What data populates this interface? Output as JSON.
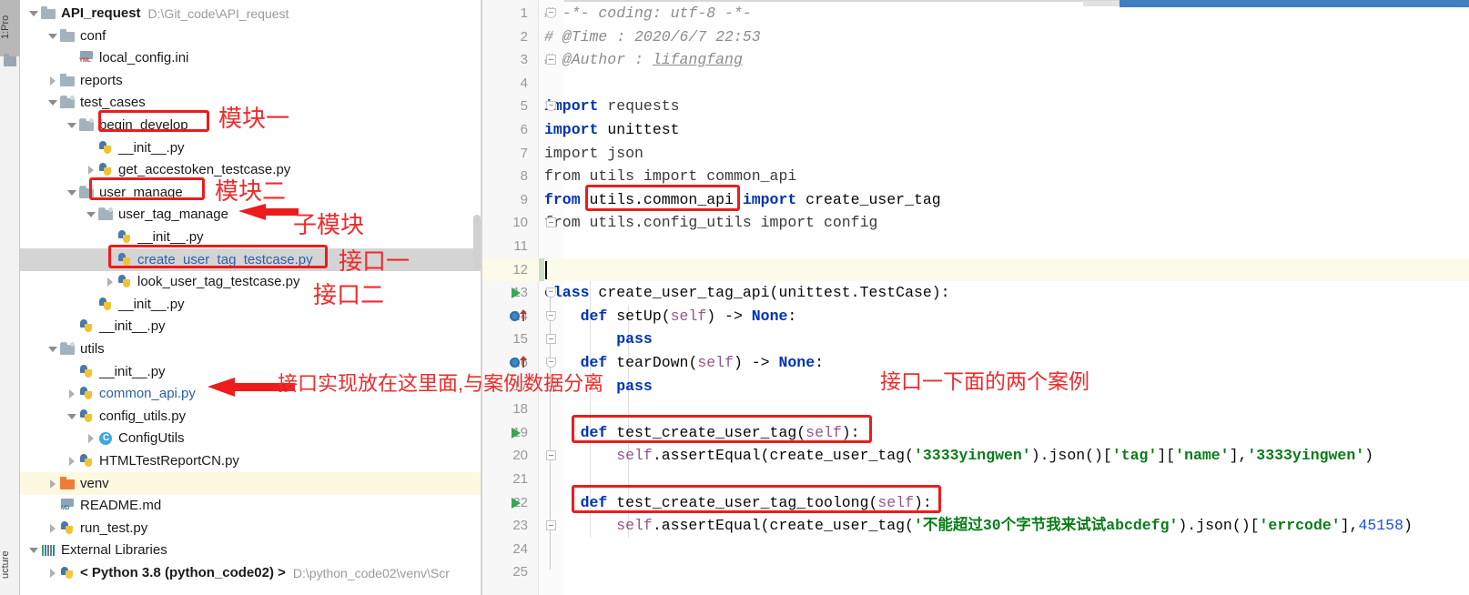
{
  "toolwindows": {
    "project_tab": "1:Pro",
    "structure_tab": "ucture",
    "folder_icon": "folder-icon"
  },
  "project_tree": {
    "root": {
      "label": "API_request",
      "path": "D:\\Git_code\\API_request"
    },
    "items": [
      {
        "label": "API_request",
        "path": "D:\\Git_code\\API_request",
        "icon": "folder-icon",
        "arrow": "down",
        "indent": 0,
        "bold": true,
        "blue": false,
        "state": "normal"
      },
      {
        "label": "conf",
        "path": "",
        "icon": "folder-icon",
        "arrow": "down",
        "indent": 1,
        "bold": false,
        "blue": false,
        "state": "normal"
      },
      {
        "label": "local_config.ini",
        "path": "",
        "icon": "ini-file-icon",
        "arrow": "none",
        "indent": 2,
        "bold": false,
        "blue": false,
        "state": "normal"
      },
      {
        "label": "reports",
        "path": "",
        "icon": "folder-icon",
        "arrow": "right",
        "indent": 1,
        "bold": false,
        "blue": false,
        "state": "normal"
      },
      {
        "label": "test_cases",
        "path": "",
        "icon": "source-folder-icon",
        "arrow": "down",
        "indent": 1,
        "bold": false,
        "blue": false,
        "state": "normal"
      },
      {
        "label": "begin_develop",
        "path": "",
        "icon": "source-folder-icon",
        "arrow": "down",
        "indent": 2,
        "bold": false,
        "blue": false,
        "state": "normal"
      },
      {
        "label": "__init__.py",
        "path": "",
        "icon": "python-file-icon",
        "arrow": "none",
        "indent": 3,
        "bold": false,
        "blue": false,
        "state": "normal"
      },
      {
        "label": "get_accestoken_testcase.py",
        "path": "",
        "icon": "python-file-icon",
        "arrow": "right",
        "indent": 3,
        "bold": false,
        "blue": false,
        "state": "normal"
      },
      {
        "label": "user_manage",
        "path": "",
        "icon": "source-folder-icon",
        "arrow": "down",
        "indent": 2,
        "bold": false,
        "blue": false,
        "state": "normal"
      },
      {
        "label": "user_tag_manage",
        "path": "",
        "icon": "source-folder-icon",
        "arrow": "down",
        "indent": 3,
        "bold": false,
        "blue": false,
        "state": "normal"
      },
      {
        "label": "__init__.py",
        "path": "",
        "icon": "python-file-icon",
        "arrow": "none",
        "indent": 4,
        "bold": false,
        "blue": false,
        "state": "normal"
      },
      {
        "label": "create_user_tag_testcase.py",
        "path": "",
        "icon": "python-file-icon",
        "arrow": "none",
        "indent": 4,
        "bold": false,
        "blue": true,
        "state": "selected"
      },
      {
        "label": "look_user_tag_testcase.py",
        "path": "",
        "icon": "python-file-icon",
        "arrow": "right",
        "indent": 4,
        "bold": false,
        "blue": false,
        "state": "normal"
      },
      {
        "label": "__init__.py",
        "path": "",
        "icon": "python-file-icon",
        "arrow": "none",
        "indent": 3,
        "bold": false,
        "blue": false,
        "state": "normal"
      },
      {
        "label": "__init__.py",
        "path": "",
        "icon": "python-file-icon",
        "arrow": "none",
        "indent": 2,
        "bold": false,
        "blue": false,
        "state": "normal"
      },
      {
        "label": "utils",
        "path": "",
        "icon": "source-folder-icon",
        "arrow": "down",
        "indent": 1,
        "bold": false,
        "blue": false,
        "state": "normal"
      },
      {
        "label": "__init__.py",
        "path": "",
        "icon": "python-file-icon",
        "arrow": "none",
        "indent": 2,
        "bold": false,
        "blue": false,
        "state": "normal"
      },
      {
        "label": "common_api.py",
        "path": "",
        "icon": "python-file-icon",
        "arrow": "right",
        "indent": 2,
        "bold": false,
        "blue": true,
        "state": "normal"
      },
      {
        "label": "config_utils.py",
        "path": "",
        "icon": "python-file-icon",
        "arrow": "down",
        "indent": 2,
        "bold": false,
        "blue": false,
        "state": "normal"
      },
      {
        "label": "ConfigUtils",
        "path": "",
        "icon": "class-icon",
        "arrow": "right",
        "indent": 3,
        "bold": false,
        "blue": false,
        "state": "normal"
      },
      {
        "label": "HTMLTestReportCN.py",
        "path": "",
        "icon": "python-file-icon",
        "arrow": "right",
        "indent": 2,
        "bold": false,
        "blue": false,
        "state": "normal"
      },
      {
        "label": "venv",
        "path": "",
        "icon": "excluded-folder-icon",
        "arrow": "right",
        "indent": 1,
        "bold": false,
        "blue": false,
        "state": "highlighted"
      },
      {
        "label": "README.md",
        "path": "",
        "icon": "markdown-file-icon",
        "arrow": "none",
        "indent": 1,
        "bold": false,
        "blue": false,
        "state": "normal"
      },
      {
        "label": "run_test.py",
        "path": "",
        "icon": "python-file-icon",
        "arrow": "right",
        "indent": 1,
        "bold": false,
        "blue": false,
        "state": "normal"
      },
      {
        "label": "External Libraries",
        "path": "",
        "icon": "libraries-icon",
        "arrow": "down",
        "indent": 0,
        "bold": false,
        "blue": false,
        "state": "normal"
      },
      {
        "label": "< Python 3.8 (python_code02) >",
        "path": "D:\\python_code02\\venv\\Scr",
        "icon": "python-interpreter-icon",
        "arrow": "right",
        "indent": 1,
        "bold": true,
        "blue": false,
        "state": "normal"
      }
    ]
  },
  "annotations": [
    {
      "id": "module-one",
      "text": "模块一",
      "color": "#ef2b2b"
    },
    {
      "id": "module-two",
      "text": "模块二",
      "color": "#ef2b2b"
    },
    {
      "id": "sub-module",
      "text": "子模块",
      "color": "#ef2b2b"
    },
    {
      "id": "interface-one",
      "text": "接口一",
      "color": "#ef2b2b"
    },
    {
      "id": "interface-two",
      "text": "接口二",
      "color": "#ef2b2b"
    },
    {
      "id": "impl-location",
      "text": "接口实现放在这里面,与案例数据分离",
      "color": "#ef2b2b"
    },
    {
      "id": "two-cases",
      "text": "接口一下面的两个案例",
      "color": "#ef2b2b"
    }
  ],
  "editor": {
    "lines": [
      {
        "n": "1",
        "segments": [
          {
            "t": "# -*- coding: utf-8 -*-",
            "c": "cmt"
          }
        ]
      },
      {
        "n": "2",
        "segments": [
          {
            "t": "# @Time : 2020/6/7 22:53",
            "c": "cmt"
          }
        ]
      },
      {
        "n": "3",
        "segments": [
          {
            "t": "# @Author : ",
            "c": "cmt"
          },
          {
            "t": "lifangfang",
            "c": "cmt-u"
          }
        ]
      },
      {
        "n": "4",
        "segments": []
      },
      {
        "n": "5",
        "segments": [
          {
            "t": "import",
            "c": "kw"
          },
          {
            "t": " requests",
            "c": "dim"
          }
        ]
      },
      {
        "n": "6",
        "segments": [
          {
            "t": "import",
            "c": "kw"
          },
          {
            "t": " unittest",
            "c": "id"
          }
        ]
      },
      {
        "n": "7",
        "segments": [
          {
            "t": "import",
            "c": "dim"
          },
          {
            "t": " json",
            "c": "dim"
          }
        ]
      },
      {
        "n": "8",
        "segments": [
          {
            "t": "from",
            "c": "dim"
          },
          {
            "t": " utils ",
            "c": "dim"
          },
          {
            "t": "import",
            "c": "dim"
          },
          {
            "t": " common_api",
            "c": "dim"
          }
        ]
      },
      {
        "n": "9",
        "segments": [
          {
            "t": "from",
            "c": "kw"
          },
          {
            "t": " utils.common_api ",
            "c": "id"
          },
          {
            "t": "import",
            "c": "kw"
          },
          {
            "t": " create_user_tag",
            "c": "id"
          }
        ]
      },
      {
        "n": "10",
        "segments": [
          {
            "t": "from",
            "c": "dim"
          },
          {
            "t": " utils.config_utils ",
            "c": "dim"
          },
          {
            "t": "import",
            "c": "dim"
          },
          {
            "t": " config",
            "c": "dim"
          }
        ]
      },
      {
        "n": "11",
        "segments": []
      },
      {
        "n": "12",
        "segments": []
      },
      {
        "n": "13",
        "segments": [
          {
            "t": "class",
            "c": "kw"
          },
          {
            "t": " create_user_tag_api(unittest.TestCase):",
            "c": "id"
          }
        ]
      },
      {
        "n": "14",
        "segments": [
          {
            "t": "    ",
            "c": "id"
          },
          {
            "t": "def",
            "c": "kw"
          },
          {
            "t": " setUp(",
            "c": "id"
          },
          {
            "t": "self",
            "c": "self"
          },
          {
            "t": ") -> ",
            "c": "id"
          },
          {
            "t": "None",
            "c": "kw"
          },
          {
            "t": ":",
            "c": "id"
          }
        ]
      },
      {
        "n": "15",
        "segments": [
          {
            "t": "        ",
            "c": "id"
          },
          {
            "t": "pass",
            "c": "kw"
          }
        ]
      },
      {
        "n": "16",
        "segments": [
          {
            "t": "    ",
            "c": "id"
          },
          {
            "t": "def",
            "c": "kw"
          },
          {
            "t": " tearDown(",
            "c": "id"
          },
          {
            "t": "self",
            "c": "self"
          },
          {
            "t": ") -> ",
            "c": "id"
          },
          {
            "t": "None",
            "c": "kw"
          },
          {
            "t": ":",
            "c": "id"
          }
        ]
      },
      {
        "n": "17",
        "segments": [
          {
            "t": "        ",
            "c": "id"
          },
          {
            "t": "pass",
            "c": "kw"
          }
        ]
      },
      {
        "n": "18",
        "segments": []
      },
      {
        "n": "19",
        "segments": [
          {
            "t": "    ",
            "c": "id"
          },
          {
            "t": "def",
            "c": "kw"
          },
          {
            "t": " test_create_user_tag(",
            "c": "id"
          },
          {
            "t": "self",
            "c": "self"
          },
          {
            "t": "):",
            "c": "id"
          }
        ]
      },
      {
        "n": "20",
        "segments": [
          {
            "t": "        ",
            "c": "id"
          },
          {
            "t": "self",
            "c": "self"
          },
          {
            "t": ".assertEqual(create_user_tag(",
            "c": "id"
          },
          {
            "t": "'3333yingwen'",
            "c": "str"
          },
          {
            "t": ").json()[",
            "c": "id"
          },
          {
            "t": "'tag'",
            "c": "str"
          },
          {
            "t": "][",
            "c": "id"
          },
          {
            "t": "'name'",
            "c": "str"
          },
          {
            "t": "],",
            "c": "id"
          },
          {
            "t": "'3333yingwen'",
            "c": "str"
          },
          {
            "t": ")",
            "c": "id"
          }
        ]
      },
      {
        "n": "21",
        "segments": []
      },
      {
        "n": "22",
        "segments": [
          {
            "t": "    ",
            "c": "id"
          },
          {
            "t": "def",
            "c": "kw"
          },
          {
            "t": " test_create_user_tag_toolong(",
            "c": "id"
          },
          {
            "t": "self",
            "c": "self"
          },
          {
            "t": "):",
            "c": "id"
          }
        ]
      },
      {
        "n": "23",
        "segments": [
          {
            "t": "        ",
            "c": "id"
          },
          {
            "t": "self",
            "c": "self"
          },
          {
            "t": ".assertEqual(create_user_tag(",
            "c": "id"
          },
          {
            "t": "'不能超过30个字节我来试试abcdefg'",
            "c": "str"
          },
          {
            "t": ").json()[",
            "c": "id"
          },
          {
            "t": "'errcode'",
            "c": "str"
          },
          {
            "t": "],",
            "c": "id"
          },
          {
            "t": "45158",
            "c": "num2"
          },
          {
            "t": ")",
            "c": "id"
          }
        ]
      },
      {
        "n": "24",
        "segments": []
      },
      {
        "n": "25",
        "segments": []
      }
    ],
    "caret_line": "12",
    "gutter_markers": [
      {
        "line": "13",
        "type": "run-arrow-icon"
      },
      {
        "line": "14",
        "type": "override-method-icon"
      },
      {
        "line": "16",
        "type": "override-method-icon"
      },
      {
        "line": "19",
        "type": "run-arrow-icon"
      },
      {
        "line": "22",
        "type": "run-arrow-icon"
      }
    ]
  },
  "colors": {
    "annotation_red": "#ef2b2b",
    "selection_grey": "#d4d4d4",
    "caret_line_yellow": "#fcfbe9",
    "keyword_blue": "#0033b3",
    "string_green": "#067d17",
    "number_blue": "#1750eb",
    "self_purple": "#94558d",
    "comment_grey": "#8c8c8c",
    "scrollbar_blue": "#3f7fc1"
  }
}
